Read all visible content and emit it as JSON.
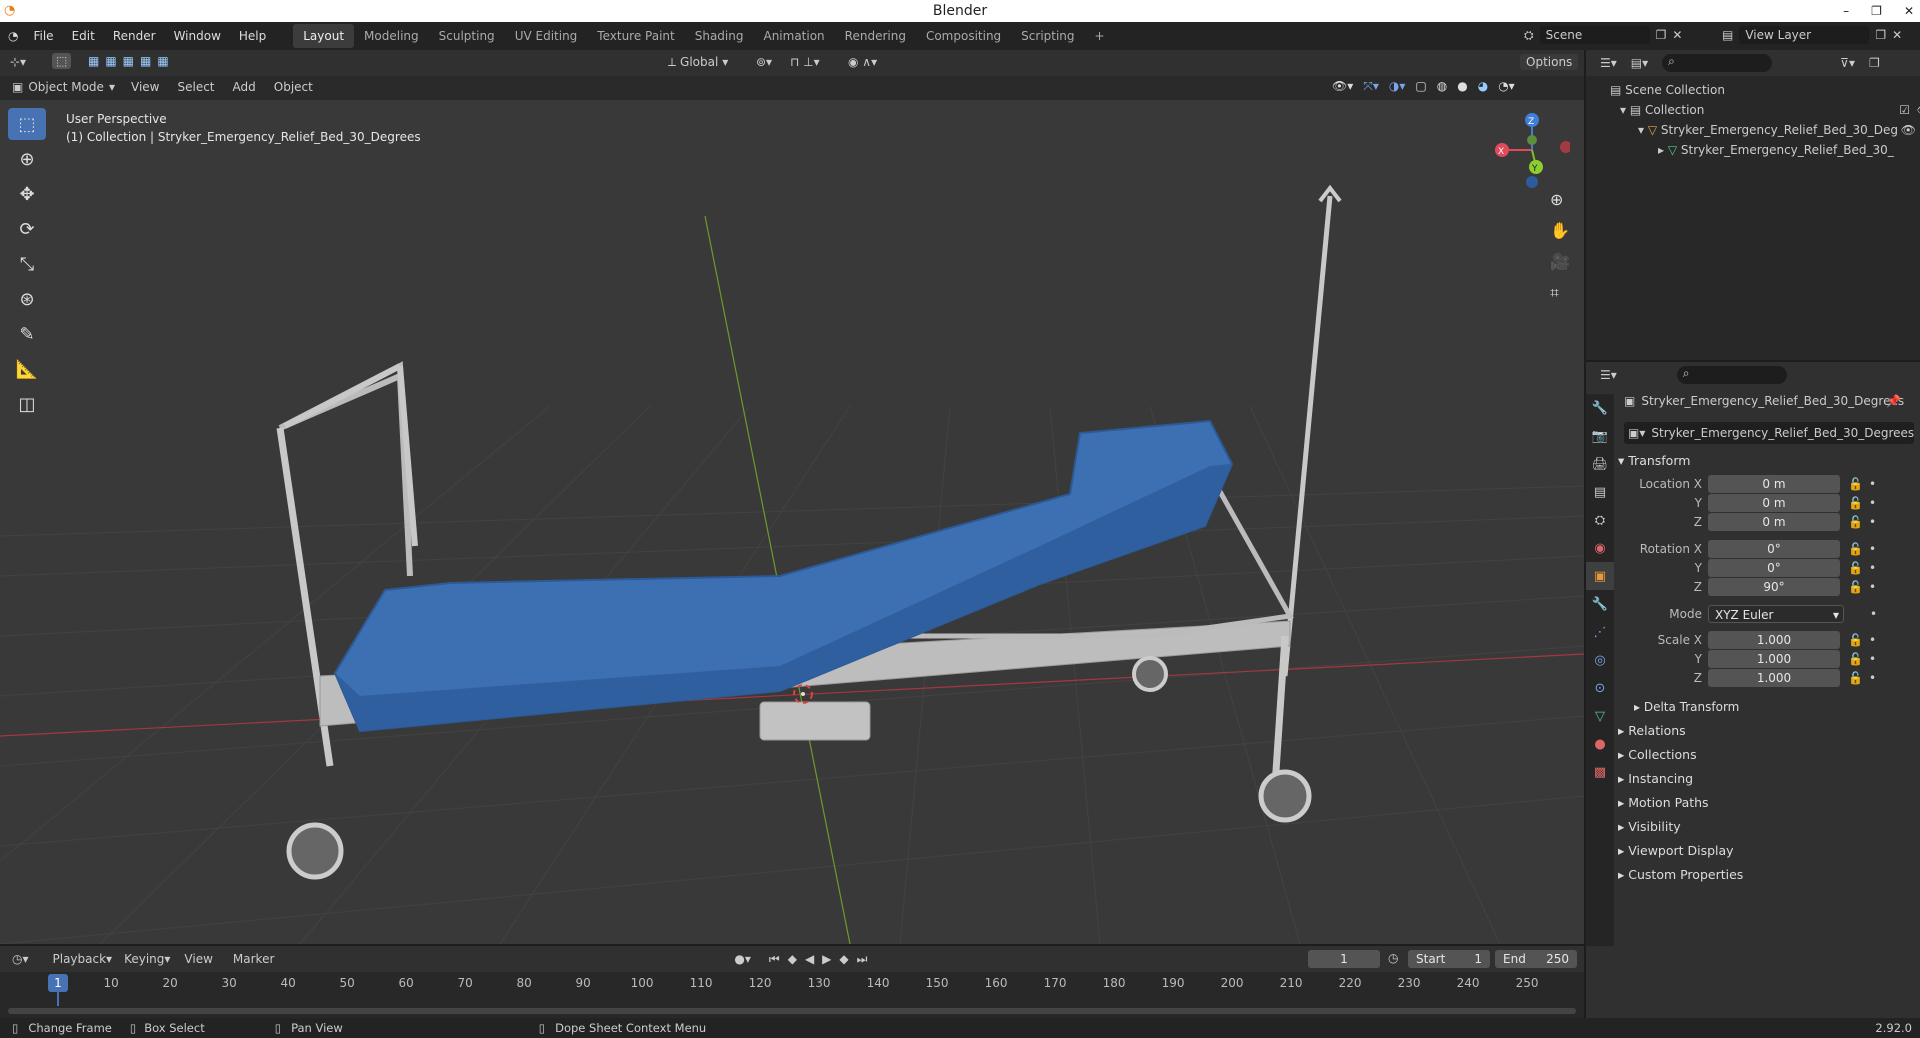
{
  "window": {
    "title": "Blender"
  },
  "menus": [
    "File",
    "Edit",
    "Render",
    "Window",
    "Help"
  ],
  "workspaces": [
    "Layout",
    "Modeling",
    "Sculpting",
    "UV Editing",
    "Texture Paint",
    "Shading",
    "Animation",
    "Rendering",
    "Compositing",
    "Scripting"
  ],
  "active_workspace": "Layout",
  "scene": {
    "label": "Scene",
    "view_layer": "View Layer"
  },
  "viewport_header": {
    "transform_orientation": "Global",
    "options": "Options",
    "mode": "Object Mode",
    "menus": [
      "View",
      "Select",
      "Add",
      "Object"
    ]
  },
  "viewport": {
    "perspective_label": "User Perspective",
    "collection_label": "(1) Collection | Stryker_Emergency_Relief_Bed_30_Degrees",
    "gizmo": {
      "x": "X",
      "y": "Y",
      "z": "Z"
    }
  },
  "outliner": {
    "scene_collection": "Scene Collection",
    "collection": "Collection",
    "object": "Stryker_Emergency_Relief_Bed_30_Deg",
    "mesh": "Stryker_Emergency_Relief_Bed_30_"
  },
  "properties": {
    "object_name": "Stryker_Emergency_Relief_Bed_30_Degrees",
    "datablock_name": "Stryker_Emergency_Relief_Bed_30_Degrees",
    "transform_label": "Transform",
    "location": {
      "label_x": "Location X",
      "x": "0 m",
      "y": "0 m",
      "z": "0 m"
    },
    "rotation": {
      "label_x": "Rotation X",
      "x": "0°",
      "y": "0°",
      "z": "90°"
    },
    "mode_label": "Mode",
    "mode": "XYZ Euler",
    "scale": {
      "label_x": "Scale X",
      "x": "1.000",
      "y": "1.000",
      "z": "1.000"
    },
    "axis_y": "Y",
    "axis_z": "Z",
    "delta_transform": "Delta Transform",
    "sections": [
      "Relations",
      "Collections",
      "Instancing",
      "Motion Paths",
      "Visibility",
      "Viewport Display",
      "Custom Properties"
    ]
  },
  "timeline": {
    "menus": [
      "Playback",
      "Keying",
      "View",
      "Marker"
    ],
    "current_frame": "1",
    "start_label": "Start",
    "start": "1",
    "end_label": "End",
    "end": "250",
    "ticks": [
      "1",
      "10",
      "20",
      "30",
      "40",
      "50",
      "60",
      "70",
      "80",
      "90",
      "100",
      "110",
      "120",
      "130",
      "140",
      "150",
      "160",
      "170",
      "180",
      "190",
      "200",
      "210",
      "220",
      "230",
      "240",
      "250"
    ]
  },
  "statusbar": {
    "items": [
      "Change Frame",
      "Box Select",
      "Pan View",
      "Dope Sheet Context Menu"
    ],
    "version": "2.92.0"
  }
}
